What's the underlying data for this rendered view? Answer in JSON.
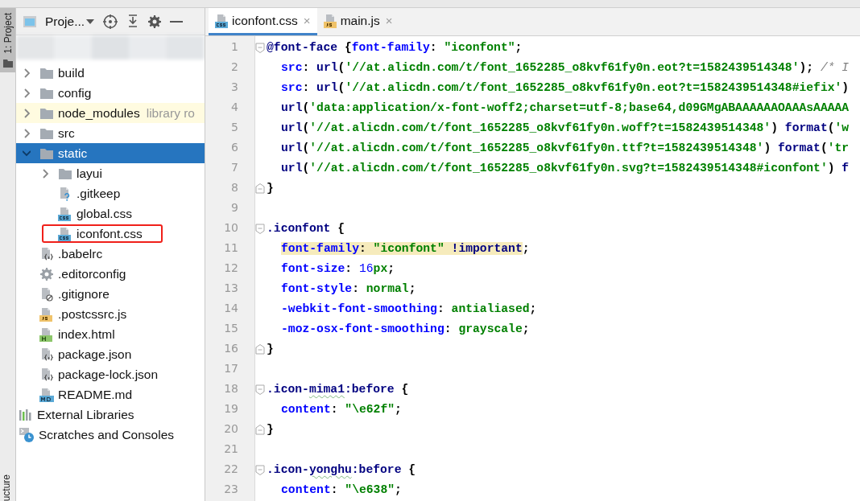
{
  "tool_stripe": {
    "top_label": "1: Project",
    "bottom_label": "ucture"
  },
  "project": {
    "title": "Proje...",
    "tree": [
      {
        "kind": "folder",
        "label": "build",
        "expanded": false,
        "selected": false,
        "library": false,
        "annotated": false
      },
      {
        "kind": "folder",
        "label": "config",
        "expanded": false,
        "selected": false,
        "library": false,
        "annotated": false
      },
      {
        "kind": "folder",
        "label": "node_modules",
        "hint": "library ro",
        "expanded": false,
        "selected": false,
        "library": true,
        "annotated": false
      },
      {
        "kind": "folder",
        "label": "src",
        "expanded": false,
        "selected": false,
        "library": false,
        "annotated": false
      },
      {
        "kind": "folder",
        "label": "static",
        "expanded": true,
        "selected": true,
        "library": false,
        "annotated": false,
        "children": [
          {
            "kind": "folder",
            "label": "layui",
            "expanded": false,
            "selected": false,
            "library": false,
            "annotated": false
          },
          {
            "kind": "unknown-file",
            "label": ".gitkeep",
            "selected": false,
            "library": false,
            "annotated": false
          },
          {
            "kind": "css-file",
            "label": "global.css",
            "selected": false,
            "library": false,
            "annotated": false
          },
          {
            "kind": "css-file",
            "label": "iconfont.css",
            "selected": false,
            "library": false,
            "annotated": true
          }
        ]
      },
      {
        "kind": "json-file",
        "label": ".babelrc",
        "selected": false,
        "library": false,
        "annotated": false
      },
      {
        "kind": "config-file",
        "label": ".editorconfig",
        "selected": false,
        "library": false,
        "annotated": false
      },
      {
        "kind": "ignore-file",
        "label": ".gitignore",
        "selected": false,
        "library": false,
        "annotated": false
      },
      {
        "kind": "js-file",
        "label": ".postcssrc.js",
        "selected": false,
        "library": false,
        "annotated": false
      },
      {
        "kind": "html-file",
        "label": "index.html",
        "selected": false,
        "library": false,
        "annotated": false
      },
      {
        "kind": "json-file",
        "label": "package.json",
        "selected": false,
        "library": false,
        "annotated": false
      },
      {
        "kind": "json-file",
        "label": "package-lock.json",
        "selected": false,
        "library": false,
        "annotated": false
      },
      {
        "kind": "md-file",
        "label": "README.md",
        "selected": false,
        "library": false,
        "annotated": false
      },
      {
        "kind": "libraries",
        "label": "External Libraries",
        "selected": false,
        "library": false,
        "annotated": false
      },
      {
        "kind": "scratches",
        "label": "Scratches and Consoles",
        "selected": false,
        "library": false,
        "annotated": false
      }
    ]
  },
  "tabs": [
    {
      "kind": "css-file",
      "label": "iconfont.css",
      "selected": true,
      "close": "×"
    },
    {
      "kind": "js-file",
      "label": "main.js",
      "selected": false,
      "close": "×"
    }
  ],
  "editor": {
    "lines": [
      {
        "number": "1",
        "kind": "fold-start",
        "tokens": [
          {
            "kind": "kw",
            "text": "@font-face"
          },
          {
            "kind": "punct",
            "text": " {"
          },
          {
            "kind": "prop",
            "text": "font-family"
          },
          {
            "kind": "punct",
            "text": ": "
          },
          {
            "kind": "str",
            "text": "\"iconfont\""
          },
          {
            "kind": "punct",
            "text": ";"
          }
        ]
      },
      {
        "number": "2",
        "indented": true,
        "tokens": [
          {
            "kind": "prop",
            "text": "src"
          },
          {
            "kind": "punct",
            "text": ": "
          },
          {
            "kind": "kw",
            "text": "url"
          },
          {
            "kind": "punct",
            "text": "("
          },
          {
            "kind": "str",
            "text": "'//at.alicdn.com/t/font_1652285_o8kvf61fy0n.eot?t=1582439514348'"
          },
          {
            "kind": "punct",
            "text": "); "
          },
          {
            "kind": "comment",
            "text": "/* I"
          }
        ]
      },
      {
        "number": "3",
        "indented": true,
        "tokens": [
          {
            "kind": "prop",
            "text": "src"
          },
          {
            "kind": "punct",
            "text": ": "
          },
          {
            "kind": "kw",
            "text": "url"
          },
          {
            "kind": "punct",
            "text": "("
          },
          {
            "kind": "str",
            "text": "'//at.alicdn.com/t/font_1652285_o8kvf61fy0n.eot?t=1582439514348#iefix'"
          },
          {
            "kind": "punct",
            "text": ")"
          }
        ]
      },
      {
        "number": "4",
        "indented": true,
        "tokens": [
          {
            "kind": "kw",
            "text": "url"
          },
          {
            "kind": "punct",
            "text": "("
          },
          {
            "kind": "str",
            "text": "'data:application/x-font-woff2;charset=utf-8;base64,d09GMgABAAAAAAOAAAsAAAAA"
          }
        ]
      },
      {
        "number": "5",
        "indented": true,
        "tokens": [
          {
            "kind": "kw",
            "text": "url"
          },
          {
            "kind": "punct",
            "text": "("
          },
          {
            "kind": "str",
            "text": "'//at.alicdn.com/t/font_1652285_o8kvf61fy0n.woff?t=1582439514348'"
          },
          {
            "kind": "punct",
            "text": ") "
          },
          {
            "kind": "kw",
            "text": "format"
          },
          {
            "kind": "punct",
            "text": "("
          },
          {
            "kind": "str",
            "text": "'w"
          }
        ]
      },
      {
        "number": "6",
        "indented": true,
        "tokens": [
          {
            "kind": "kw",
            "text": "url"
          },
          {
            "kind": "punct",
            "text": "("
          },
          {
            "kind": "str",
            "text": "'//at.alicdn.com/t/font_1652285_o8kvf61fy0n.ttf?t=1582439514348'"
          },
          {
            "kind": "punct",
            "text": ") "
          },
          {
            "kind": "kw",
            "text": "format"
          },
          {
            "kind": "punct",
            "text": "("
          },
          {
            "kind": "str",
            "text": "'tr"
          }
        ]
      },
      {
        "number": "7",
        "indented": true,
        "tokens": [
          {
            "kind": "kw",
            "text": "url"
          },
          {
            "kind": "punct",
            "text": "("
          },
          {
            "kind": "str",
            "text": "'//at.alicdn.com/t/font_1652285_o8kvf61fy0n.svg?t=1582439514348#iconfont'"
          },
          {
            "kind": "punct",
            "text": ") "
          },
          {
            "kind": "kw",
            "text": "f"
          }
        ]
      },
      {
        "number": "8",
        "kind": "fold-end",
        "tokens": [
          {
            "kind": "punct",
            "text": "}"
          }
        ]
      },
      {
        "number": "9"
      },
      {
        "number": "10",
        "kind": "fold-start",
        "tokens": [
          {
            "kind": "sel",
            "text": ".iconfont"
          },
          {
            "kind": "punct",
            "text": " {"
          }
        ]
      },
      {
        "number": "11",
        "indented": true,
        "tokens": [
          {
            "kind": "prop",
            "text": "font-family",
            "highlight": true
          },
          {
            "kind": "punct",
            "text": ": ",
            "highlight": true
          },
          {
            "kind": "str",
            "text": "\"iconfont\"",
            "highlight": true
          },
          {
            "kind": "kw",
            "text": " !important",
            "highlight": true
          },
          {
            "kind": "punct",
            "text": ";"
          }
        ]
      },
      {
        "number": "12",
        "indented": true,
        "tokens": [
          {
            "kind": "prop",
            "text": "font-size"
          },
          {
            "kind": "punct",
            "text": ": "
          },
          {
            "kind": "num",
            "text": "16"
          },
          {
            "kind": "str",
            "text": "px"
          },
          {
            "kind": "punct",
            "text": ";"
          }
        ]
      },
      {
        "number": "13",
        "indented": true,
        "tokens": [
          {
            "kind": "prop",
            "text": "font-style"
          },
          {
            "kind": "punct",
            "text": ": "
          },
          {
            "kind": "str",
            "text": "normal"
          },
          {
            "kind": "punct",
            "text": ";"
          }
        ]
      },
      {
        "number": "14",
        "indented": true,
        "tokens": [
          {
            "kind": "prop",
            "text": "-webkit-font-smoothing"
          },
          {
            "kind": "punct",
            "text": ": "
          },
          {
            "kind": "str",
            "text": "antialiased"
          },
          {
            "kind": "punct",
            "text": ";"
          }
        ]
      },
      {
        "number": "15",
        "indented": true,
        "tokens": [
          {
            "kind": "prop",
            "text": "-moz-osx-font-smoothing"
          },
          {
            "kind": "punct",
            "text": ": "
          },
          {
            "kind": "str",
            "text": "grayscale"
          },
          {
            "kind": "punct",
            "text": ";"
          }
        ]
      },
      {
        "number": "16",
        "kind": "fold-end",
        "tokens": [
          {
            "kind": "punct",
            "text": "}"
          }
        ]
      },
      {
        "number": "17"
      },
      {
        "number": "18",
        "kind": "fold-start",
        "tokens": [
          {
            "kind": "sel",
            "text": ".icon-"
          },
          {
            "kind": "sel",
            "text": "mima1",
            "typo": true
          },
          {
            "kind": "sel",
            "text": ":before"
          },
          {
            "kind": "punct",
            "text": " {"
          }
        ]
      },
      {
        "number": "19",
        "indented": true,
        "tokens": [
          {
            "kind": "prop",
            "text": "content"
          },
          {
            "kind": "punct",
            "text": ": "
          },
          {
            "kind": "str",
            "text": "\"\\e62f\""
          },
          {
            "kind": "punct",
            "text": ";"
          }
        ]
      },
      {
        "number": "20",
        "kind": "fold-end",
        "tokens": [
          {
            "kind": "punct",
            "text": "}"
          }
        ]
      },
      {
        "number": "21"
      },
      {
        "number": "22",
        "kind": "fold-start",
        "tokens": [
          {
            "kind": "sel",
            "text": ".icon-"
          },
          {
            "kind": "sel",
            "text": "yonghu",
            "typo": true
          },
          {
            "kind": "sel",
            "text": ":before"
          },
          {
            "kind": "punct",
            "text": " {"
          }
        ]
      },
      {
        "number": "23",
        "indented": true,
        "tokens": [
          {
            "kind": "prop",
            "text": "content"
          },
          {
            "kind": "punct",
            "text": ": "
          },
          {
            "kind": "str",
            "text": "\"\\e638\""
          },
          {
            "kind": "punct",
            "text": ";"
          }
        ]
      }
    ]
  }
}
